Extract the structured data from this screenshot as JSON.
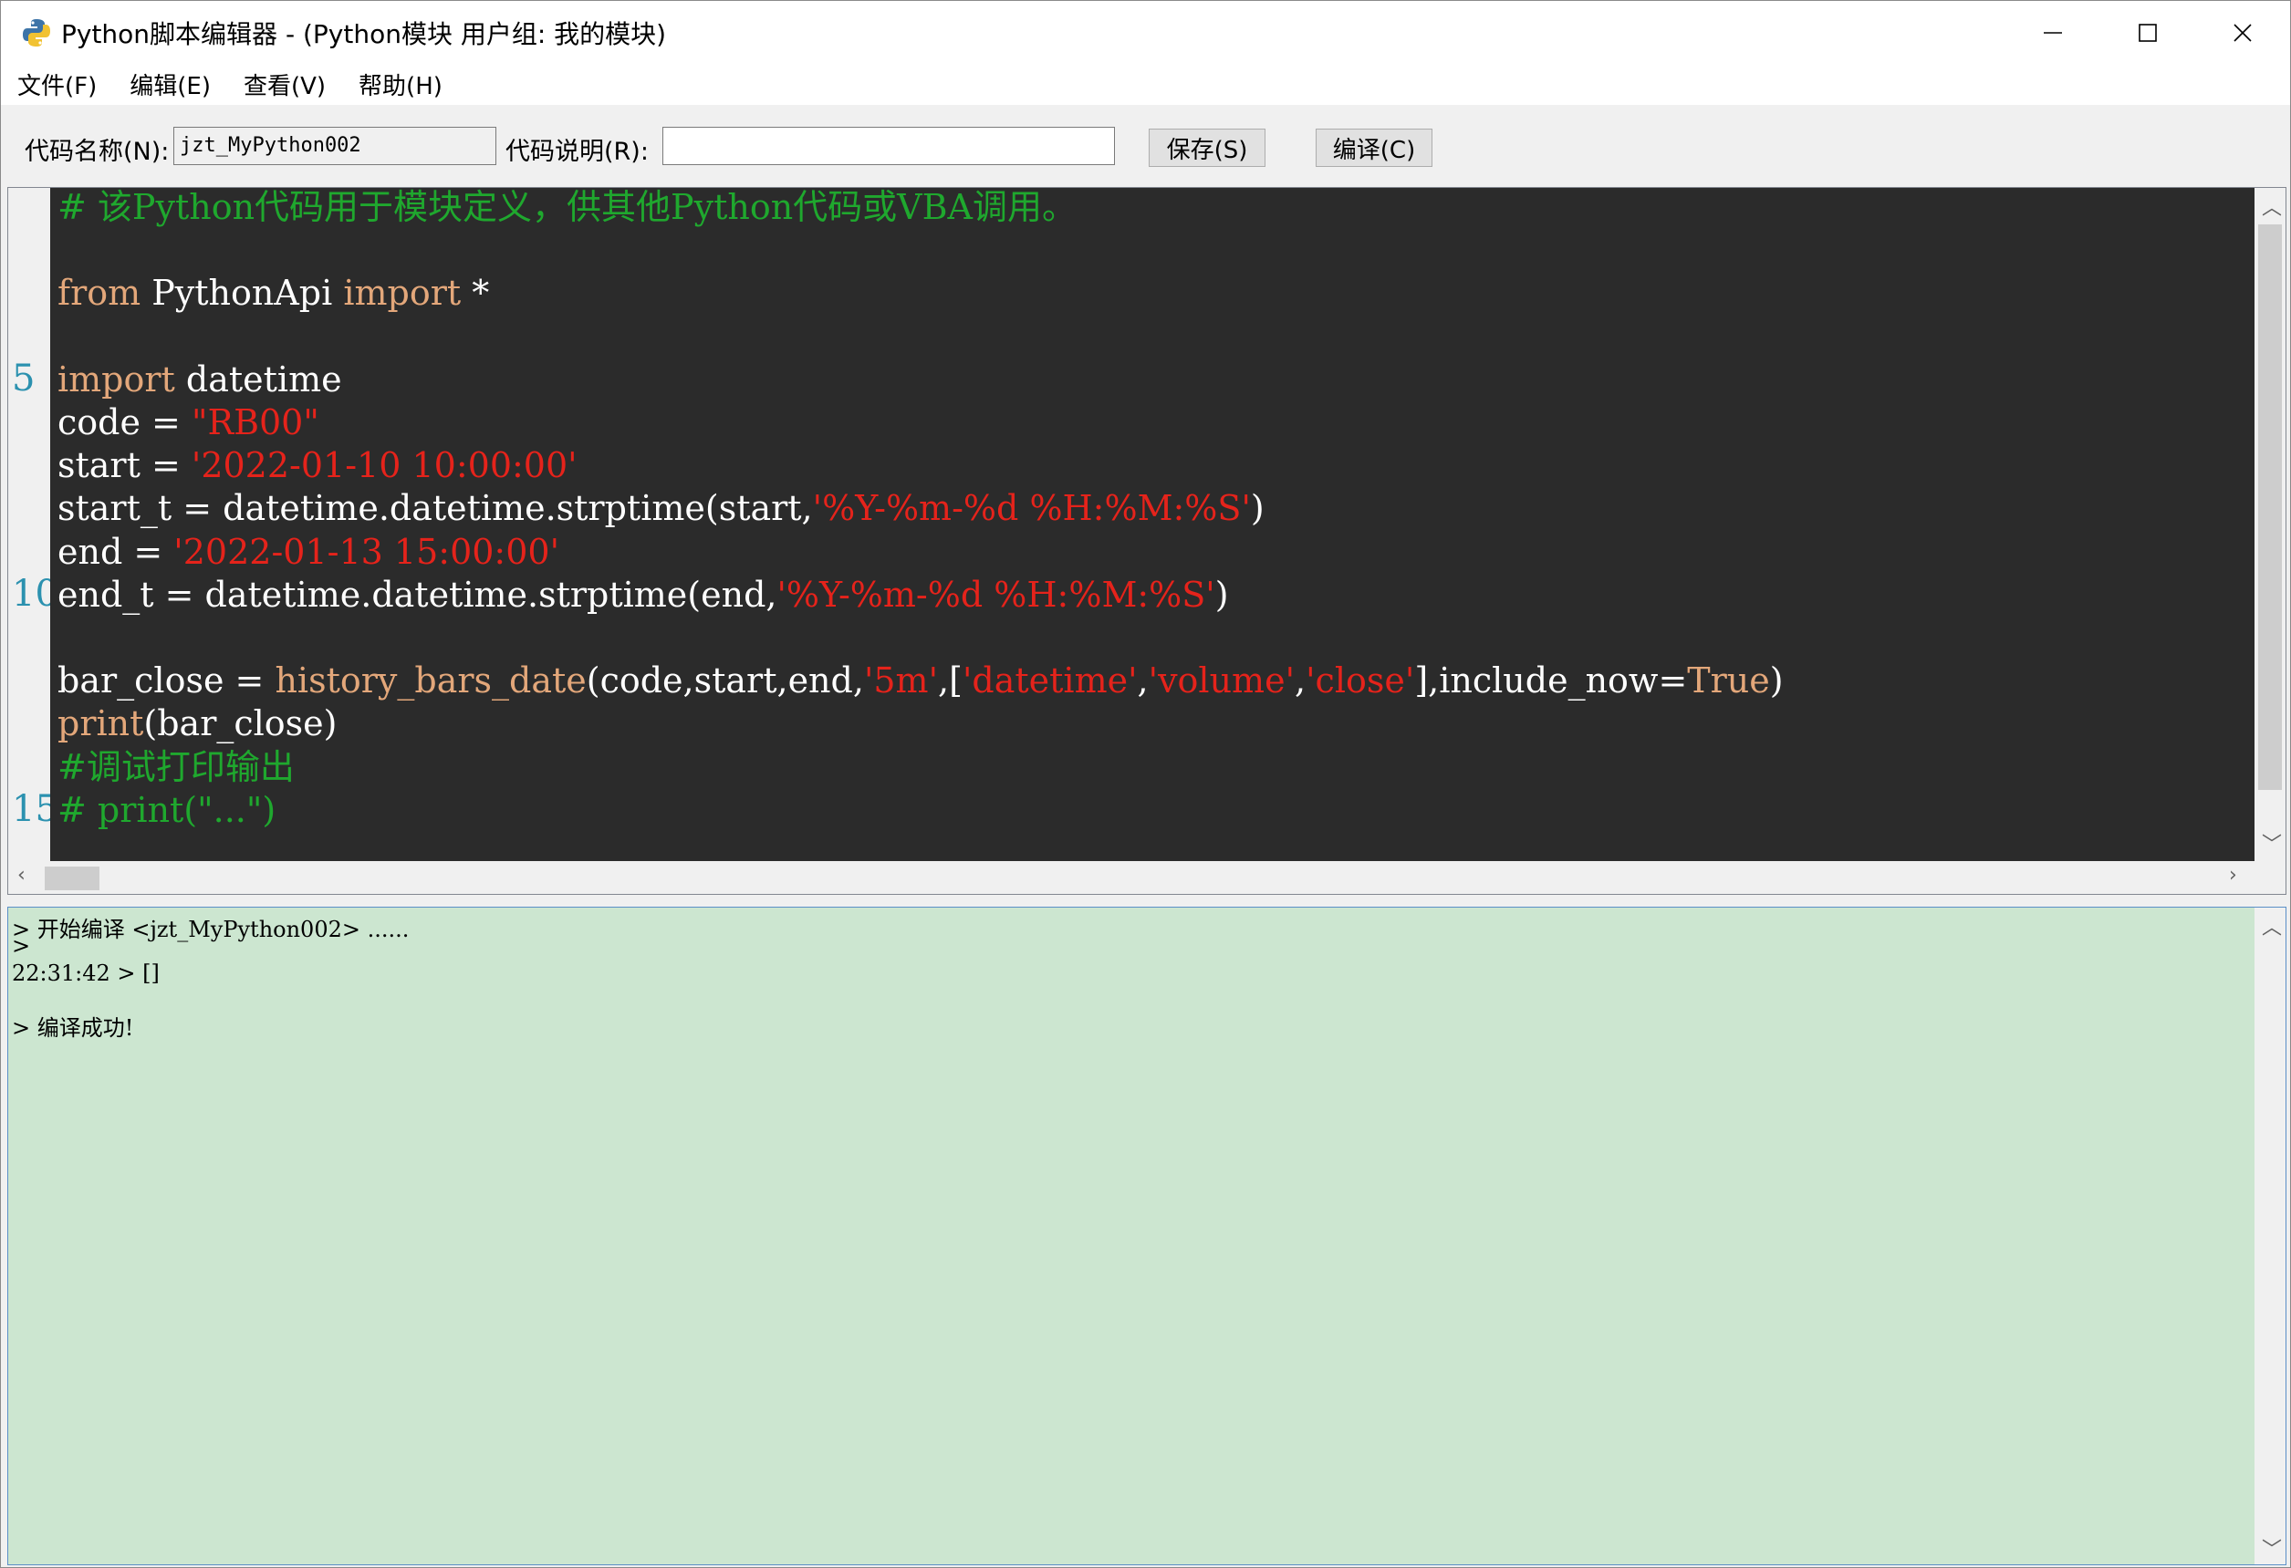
{
  "window": {
    "title": "Python脚本编辑器 - (Python模块 用户组: 我的模块)"
  },
  "menu": {
    "items": [
      "文件(F)",
      "编辑(E)",
      "查看(V)",
      "帮助(H)"
    ]
  },
  "toolbar": {
    "name_label": "代码名称(N):",
    "name_value": "jzt_MyPython002",
    "desc_label": "代码说明(R):",
    "desc_value": "",
    "save_label": "保存(S)",
    "compile_label": "编译(C)"
  },
  "editor": {
    "line_numbers": [
      "5",
      "10",
      "15"
    ],
    "lines": [
      "# 该Python代码用于模块定义，供其他Python代码或VBA调用。",
      "",
      "from PythonApi import *",
      "",
      "import datetime",
      "code = \"RB00\"",
      "start = '2022-01-10 10:00:00'",
      "start_t = datetime.datetime.strptime(start,'%Y-%m-%d %H:%M:%S')",
      "end = '2022-01-13 15:00:00'",
      "end_t = datetime.datetime.strptime(end,'%Y-%m-%d %H:%M:%S')",
      "",
      "bar_close = history_bars_date(code,start,end,'5m',['datetime','volume','close'],include_now=True)",
      "print(bar_close)",
      "#调试打印输出",
      "# print(\"...\")"
    ]
  },
  "output": {
    "lines": [
      "> 开始编译 <jzt_MyPython002> ......",
      ">",
      "22:31:42 > []",
      "",
      "> 编译成功!"
    ]
  },
  "colors": {
    "editor_bg": "#2b2b2b",
    "keyword": "#e3a77a",
    "string": "#e5231b",
    "comment": "#1fa82e",
    "output_bg": "#cce6d0"
  }
}
